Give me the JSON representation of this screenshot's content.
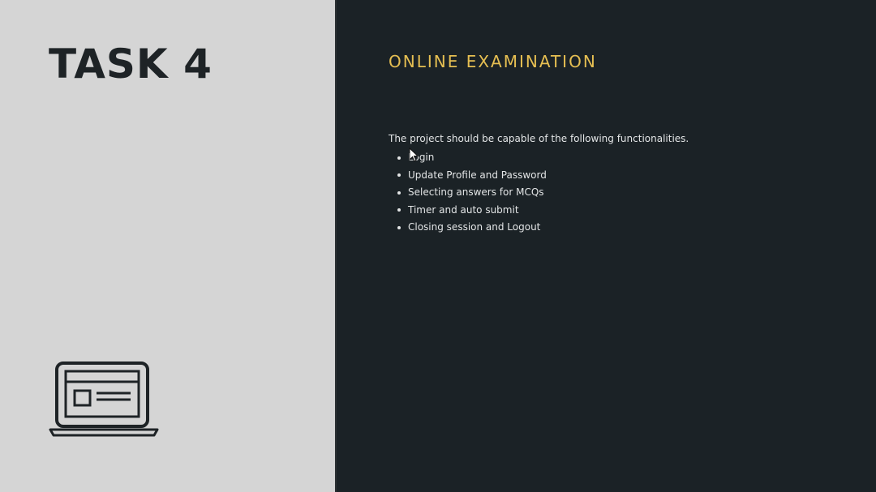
{
  "left_panel": {
    "title": "TASK 4",
    "icon": "laptop-icon"
  },
  "right_panel": {
    "title": "ONLINE EXAMINATION",
    "intro": "The project should be capable of the following functionalities.",
    "items": [
      {
        "label": "Login"
      },
      {
        "label": "Update Profile and Password"
      },
      {
        "label": "Selecting answers for MCQs"
      },
      {
        "label": "Timer and auto submit"
      },
      {
        "label": "Closing session and Logout"
      }
    ]
  },
  "colors": {
    "left_background": "#d5d5d5",
    "right_background": "#1b2226",
    "title_dark": "#1e2326",
    "accent_gold": "#e6bf52",
    "body_text": "#e3e5e6"
  }
}
